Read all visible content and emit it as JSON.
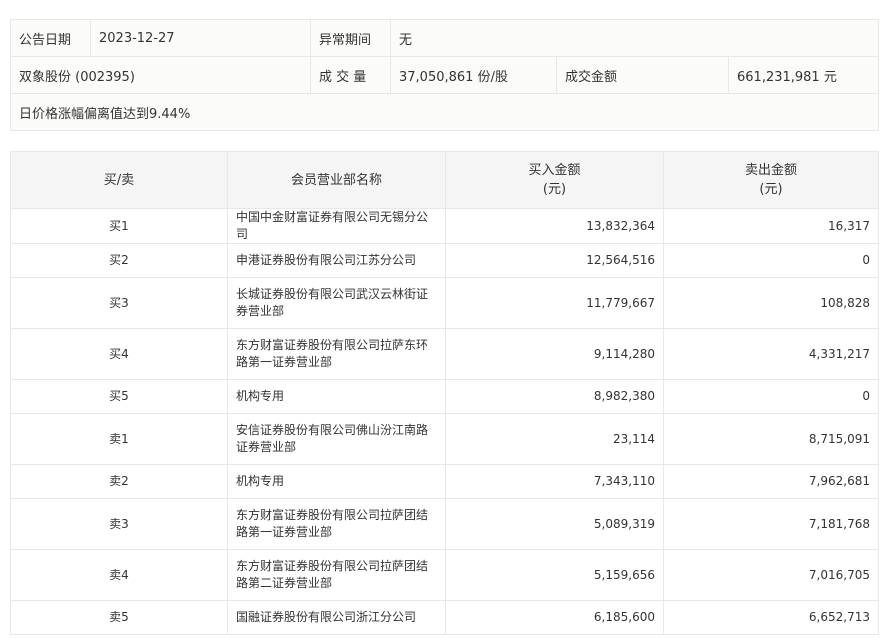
{
  "info": {
    "date_label": "公告日期",
    "date": "2023-12-27",
    "period_label": "异常期间",
    "period": "无",
    "stock": "双象股份 (002395)",
    "volume_label": "成 交 量",
    "volume": "37,050,861 份/股",
    "amount_label": "成交金额",
    "amount": "661,231,981 元",
    "reason": "日价格涨幅偏离值达到9.44%"
  },
  "table": {
    "headers": [
      "买/卖",
      "会员营业部名称",
      "买入金额",
      "(元)",
      "卖出金额",
      "(元)"
    ],
    "rows": [
      {
        "side": "买1",
        "name": "中国中金财富证券有限公司无锡分公司",
        "buy": "13,832,364",
        "sell": "16,317"
      },
      {
        "side": "买2",
        "name": "申港证券股份有限公司江苏分公司",
        "buy": "12,564,516",
        "sell": "0"
      },
      {
        "side": "买3",
        "name": "长城证券股份有限公司武汉云林街证券营业部",
        "buy": "11,779,667",
        "sell": "108,828"
      },
      {
        "side": "买4",
        "name": "东方财富证券股份有限公司拉萨东环路第一证券营业部",
        "buy": "9,114,280",
        "sell": "4,331,217"
      },
      {
        "side": "买5",
        "name": "机构专用",
        "buy": "8,982,380",
        "sell": "0"
      },
      {
        "side": "卖1",
        "name": "安信证券股份有限公司佛山汾江南路证券营业部",
        "buy": "23,114",
        "sell": "8,715,091"
      },
      {
        "side": "卖2",
        "name": "机构专用",
        "buy": "7,343,110",
        "sell": "7,962,681"
      },
      {
        "side": "卖3",
        "name": "东方财富证券股份有限公司拉萨团结路第一证券营业部",
        "buy": "5,089,319",
        "sell": "7,181,768"
      },
      {
        "side": "卖4",
        "name": "东方财富证券股份有限公司拉萨团结路第二证券营业部",
        "buy": "5,159,656",
        "sell": "7,016,705"
      },
      {
        "side": "卖5",
        "name": "国融证券股份有限公司浙江分公司",
        "buy": "6,185,600",
        "sell": "6,652,713"
      }
    ]
  }
}
